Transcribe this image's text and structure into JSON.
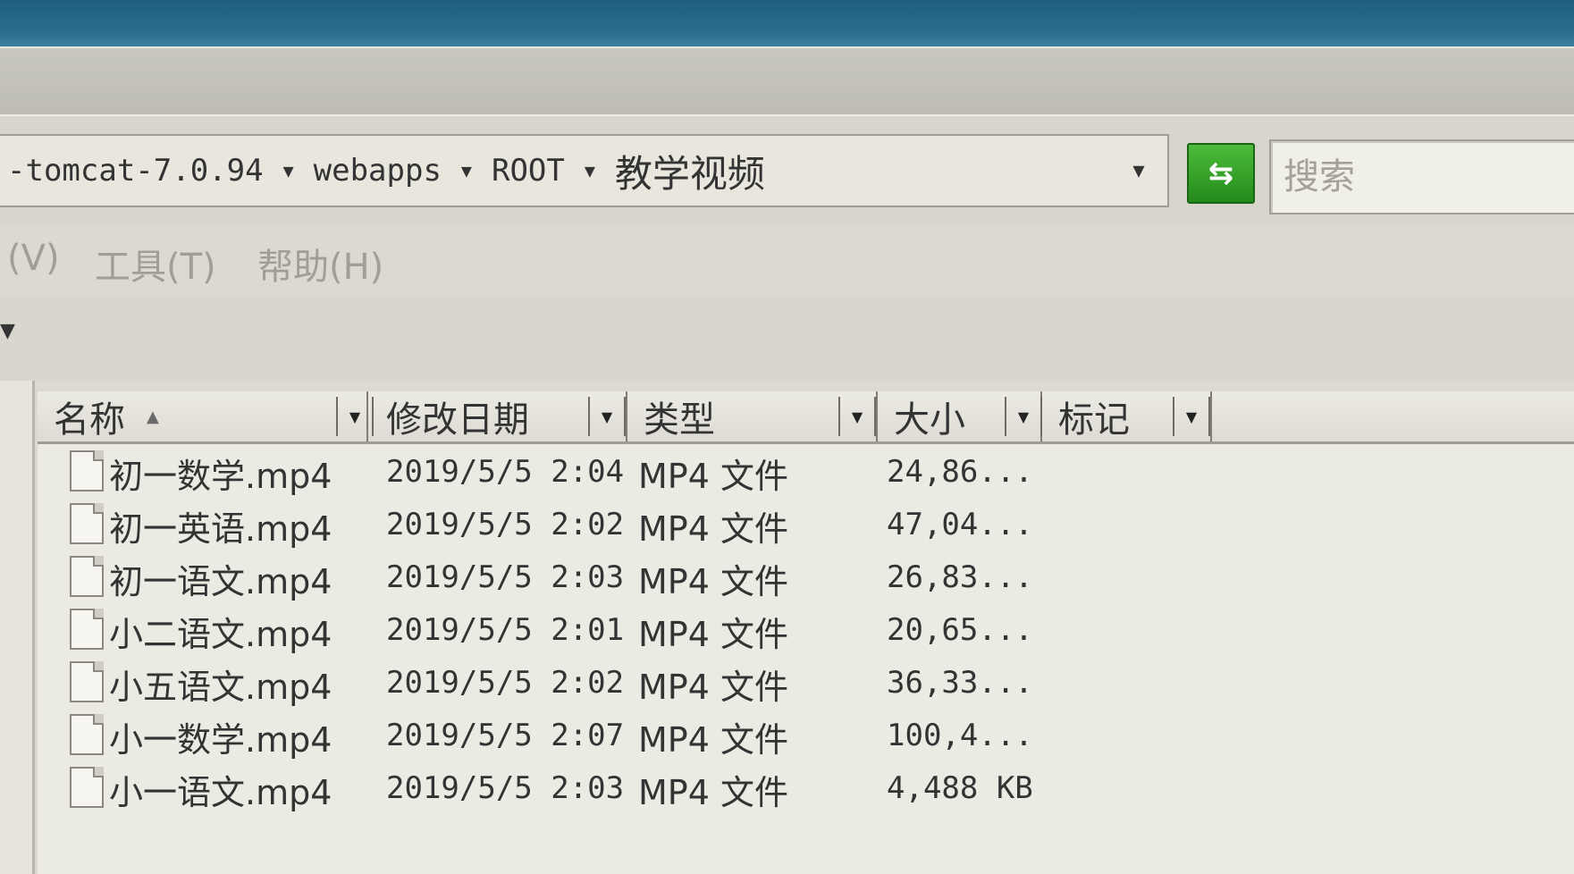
{
  "address": {
    "crumbs": [
      "-tomcat-7.0.94",
      "webapps",
      "ROOT",
      "教学视频"
    ],
    "go_symbol": "⇆"
  },
  "search": {
    "placeholder": "搜索"
  },
  "menu": {
    "items": [
      "(V)",
      "工具(T)",
      "帮助(H)"
    ]
  },
  "list": {
    "columns": [
      "名称",
      "修改日期",
      "类型",
      "大小",
      "标记"
    ],
    "rows": [
      {
        "name": "初一数学.mp4",
        "date": "2019/5/5 2:04",
        "type": "MP4 文件",
        "size": "24,86..."
      },
      {
        "name": "初一英语.mp4",
        "date": "2019/5/5 2:02",
        "type": "MP4 文件",
        "size": "47,04..."
      },
      {
        "name": "初一语文.mp4",
        "date": "2019/5/5 2:03",
        "type": "MP4 文件",
        "size": "26,83..."
      },
      {
        "name": "小二语文.mp4",
        "date": "2019/5/5 2:01",
        "type": "MP4 文件",
        "size": "20,65..."
      },
      {
        "name": "小五语文.mp4",
        "date": "2019/5/5 2:02",
        "type": "MP4 文件",
        "size": "36,33..."
      },
      {
        "name": "小一数学.mp4",
        "date": "2019/5/5 2:07",
        "type": "MP4 文件",
        "size": "100,4..."
      },
      {
        "name": "小一语文.mp4",
        "date": "2019/5/5 2:03",
        "type": "MP4 文件",
        "size": "4,488 KB"
      }
    ]
  }
}
